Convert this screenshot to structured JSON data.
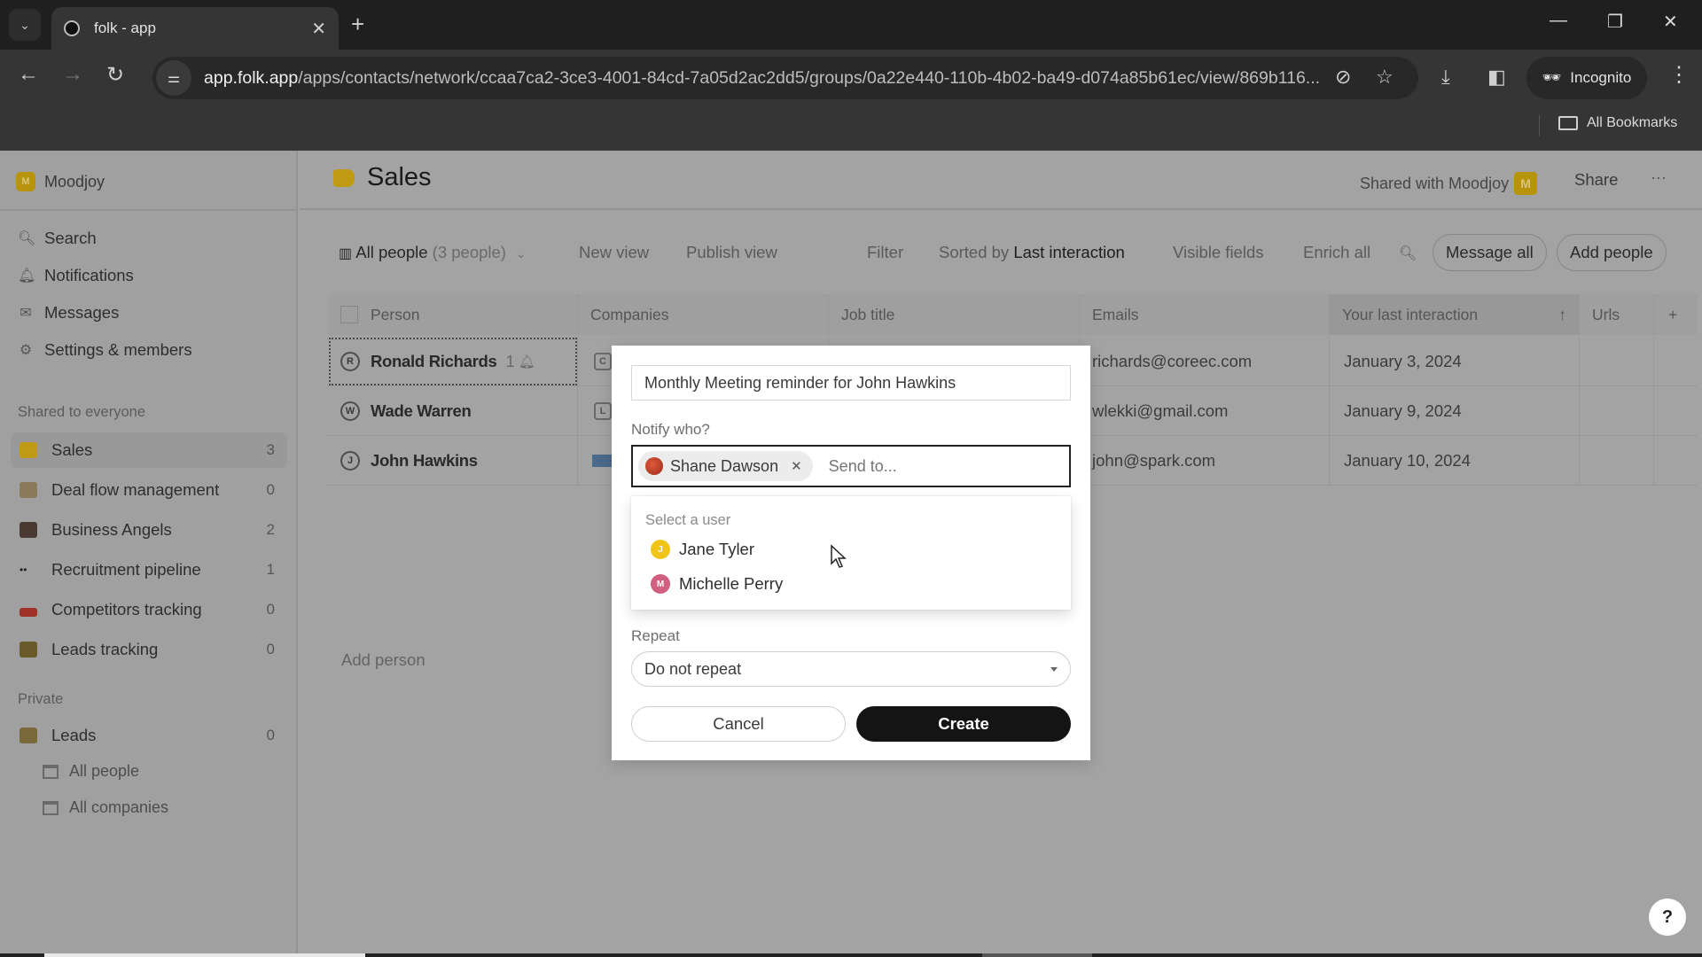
{
  "browser": {
    "tab_title": "folk - app",
    "url_host": "app.folk.app",
    "url_path": "/apps/contacts/network/ccaa7ca2-3ce3-4001-84cd-7a05d2ac2dd5/groups/0a22e440-110b-4b02-ba49-d074a85b61ec/view/869b116...",
    "incognito_label": "Incognito",
    "bookmarks_label": "All Bookmarks",
    "icons": {
      "tab_search": "chevron-down-icon",
      "favicon": "folk-favicon",
      "close_tab": "close-icon",
      "new_tab": "plus-icon",
      "back": "arrow-left-icon",
      "forward": "arrow-right-icon",
      "reload": "reload-icon",
      "site_info": "tune-icon",
      "eye_off": "eye-off-icon",
      "star": "star-icon",
      "download": "download-icon",
      "sidepanel": "side-panel-icon",
      "menu": "kebab-icon"
    }
  },
  "sidebar": {
    "workspace": {
      "badge": "M",
      "name": "Moodjoy"
    },
    "nav": [
      {
        "label": "Search",
        "icon": "search-icon"
      },
      {
        "label": "Notifications",
        "icon": "bell-icon"
      },
      {
        "label": "Messages",
        "icon": "mail-icon"
      },
      {
        "label": "Settings & members",
        "icon": "gear-icon"
      }
    ],
    "shared_section_title": "Shared to everyone",
    "shared_groups": [
      {
        "label": "Sales",
        "count": "3",
        "active": true,
        "color": "#c09a12"
      },
      {
        "label": "Deal flow management",
        "count": "0",
        "active": false,
        "color": "#8a7a5a"
      },
      {
        "label": "Business Angels",
        "count": "2",
        "active": false,
        "color": "#4a3a32"
      },
      {
        "label": "Recruitment pipeline",
        "count": "1",
        "active": false,
        "color": "#2a2a2a"
      },
      {
        "label": "Competitors tracking",
        "count": "0",
        "active": false,
        "color": "#a0302a"
      },
      {
        "label": "Leads tracking",
        "count": "0",
        "active": false,
        "color": "#6a5a2a"
      }
    ],
    "private_section_title": "Private",
    "private_groups": [
      {
        "label": "Leads",
        "count": "0",
        "color": "#7a6a3a"
      }
    ],
    "private_subviews": [
      {
        "label": "All people"
      },
      {
        "label": "All companies"
      }
    ]
  },
  "header": {
    "title": "Sales",
    "shared_with": "Shared with Moodjoy",
    "shared_badge": "M",
    "share_label": "Share",
    "more_label": "···"
  },
  "toolbar": {
    "view_label": "All people",
    "view_count": "(3 people)",
    "new_view": "New view",
    "publish_view": "Publish view",
    "filter": "Filter",
    "sorted_prefix": "Sorted by",
    "sorted_field": "Last interaction",
    "visible_fields": "Visible fields",
    "enrich_all": "Enrich all",
    "message_all": "Message all",
    "add_people": "Add people"
  },
  "table": {
    "columns": [
      "Person",
      "Companies",
      "Job title",
      "Emails",
      "Your last interaction",
      "Urls"
    ],
    "sort_indicator": "↑",
    "add_column": "+",
    "rows": [
      {
        "initial": "R",
        "name": "Ronald Richards",
        "reminders": "1",
        "company_initial": "C",
        "job_title": "",
        "email": "richards@coreec.com",
        "last_interaction": "January 3, 2024",
        "urls": ""
      },
      {
        "initial": "W",
        "name": "Wade Warren",
        "reminders": "",
        "company_initial": "L",
        "job_title": "",
        "email": "wlekki@gmail.com",
        "last_interaction": "January 9, 2024",
        "urls": ""
      },
      {
        "initial": "J",
        "name": "John Hawkins",
        "reminders": "",
        "company_initial": "",
        "job_title": "",
        "email": "john@spark.com",
        "last_interaction": "January 10, 2024",
        "urls": ""
      }
    ],
    "add_person": "Add person"
  },
  "modal": {
    "reminder_title": "Monthly Meeting reminder for John Hawkins",
    "notify_label": "Notify who?",
    "selected_recipients": [
      {
        "name": "Shane Dawson"
      }
    ],
    "send_to_placeholder": "Send to...",
    "dropdown": {
      "header": "Select a user",
      "options": [
        {
          "initial": "J",
          "name": "Jane Tyler",
          "color": "#f0c419"
        },
        {
          "initial": "M",
          "name": "Michelle Perry",
          "color": "#d0607e"
        }
      ]
    },
    "repeat_label": "Repeat",
    "repeat_value": "Do not repeat",
    "cancel_label": "Cancel",
    "create_label": "Create"
  },
  "help": {
    "label": "?"
  }
}
